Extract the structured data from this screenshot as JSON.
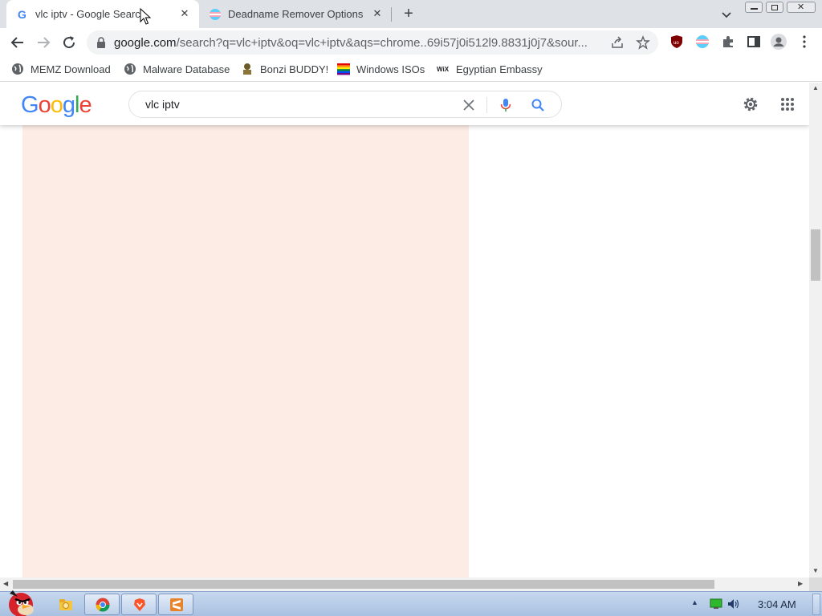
{
  "browser": {
    "tabs": [
      {
        "title": "vlc iptv - Google Search",
        "active": true,
        "icon": "google-g-icon"
      },
      {
        "title": "Deadname Remover Options",
        "active": false,
        "icon": "trans-flag-icon"
      }
    ],
    "url_host": "google.com",
    "url_path": "/search?q=vlc+iptv&oq=vlc+iptv&aqs=chrome..69i57j0i512l9.8831j0j7&sour...",
    "bookmarks": [
      {
        "label": "MEMZ Download",
        "icon": "globe-icon"
      },
      {
        "label": "Malware Database",
        "icon": "globe-icon"
      },
      {
        "label": "Bonzi BUDDY!",
        "icon": "bonzi-icon"
      },
      {
        "label": "Windows ISOs",
        "icon": "rainbow-flag-icon"
      },
      {
        "label": "Egyptian Embassy",
        "icon": "wix-icon"
      }
    ]
  },
  "google": {
    "logo_letters": [
      "G",
      "o",
      "o",
      "g",
      "l",
      "e"
    ],
    "logo_colors": [
      "#4285f4",
      "#ea4335",
      "#fbbc05",
      "#4285f4",
      "#34a853",
      "#ea4335"
    ],
    "query": "vlc iptv",
    "panel_color": "#fdece5"
  },
  "taskbar": {
    "clock": "3:04 AM",
    "pinned": [
      "explorer-icon",
      "chrome-icon",
      "brave-icon",
      "sublime-icon"
    ]
  }
}
